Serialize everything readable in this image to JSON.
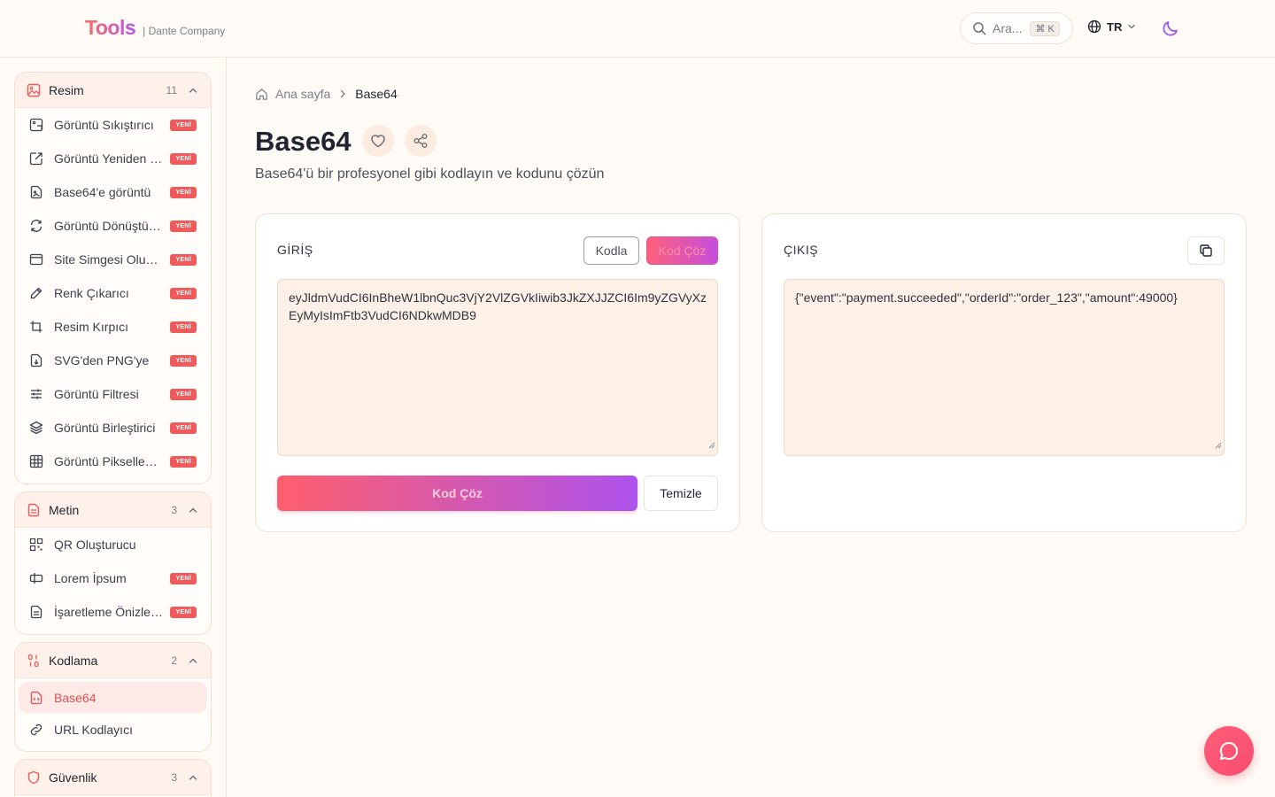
{
  "header": {
    "logo": "Tools",
    "company": "| Dante Company",
    "search_placeholder": "Ara...",
    "search_shortcut": "⌘ K",
    "language": "TR"
  },
  "sidebar": {
    "groups": [
      {
        "title": "Resim",
        "count": "11",
        "items": [
          {
            "label": "Görüntü Sıkıştırıcı",
            "badge": "YENİ"
          },
          {
            "label": "Görüntü Yeniden Boyutlandırıcı",
            "badge": "YENİ"
          },
          {
            "label": "Base64'e görüntü",
            "badge": "YENİ"
          },
          {
            "label": "Görüntü Dönüştürücü",
            "badge": "YENİ"
          },
          {
            "label": "Site Simgesi Oluşturucu",
            "badge": "YENİ"
          },
          {
            "label": "Renk Çıkarıcı",
            "badge": "YENİ"
          },
          {
            "label": "Resim Kırpıcı",
            "badge": "YENİ"
          },
          {
            "label": "SVG'den PNG'ye",
            "badge": "YENİ"
          },
          {
            "label": "Görüntü Filtresi",
            "badge": "YENİ"
          },
          {
            "label": "Görüntü Birleştirici",
            "badge": "YENİ"
          },
          {
            "label": "Görüntü Pikselleştirici",
            "badge": "YENİ"
          }
        ]
      },
      {
        "title": "Metin",
        "count": "3",
        "items": [
          {
            "label": "QR Oluşturucu",
            "badge": ""
          },
          {
            "label": "Lorem İpsum",
            "badge": "YENİ"
          },
          {
            "label": "İşaretleme Önizleyici",
            "badge": "YENİ"
          }
        ]
      },
      {
        "title": "Kodlama",
        "count": "2",
        "items": [
          {
            "label": "Base64",
            "badge": ""
          },
          {
            "label": "URL Kodlayıcı",
            "badge": ""
          }
        ]
      },
      {
        "title": "Güvenlik",
        "count": "3",
        "items": []
      }
    ]
  },
  "breadcrumb": {
    "home": "Ana sayfa",
    "current": "Base64"
  },
  "page": {
    "title": "Base64",
    "subtitle": "Base64'ü bir profesyonel gibi kodlayın ve kodunu çözün"
  },
  "input_panel": {
    "label": "GİRİŞ",
    "encode_label": "Kodla",
    "decode_label": "Kod Çöz",
    "value": "eyJldmVudCI6InBheW1lbnQuc3VjY2VlZGVkIiwib3JkZXJJZCI6Im9yZGVyXzEyMyIsImFtb3VudCI6NDkwMDB9",
    "primary_label": "Kod Çöz",
    "clear_label": "Temizle"
  },
  "output_panel": {
    "label": "ÇIKIŞ",
    "value": "{\"event\":\"payment.succeeded\",\"orderId\":\"order_123\",\"amount\":49000}"
  },
  "colors": {
    "accent": "#f05a5a",
    "gradient_start": "#ff5f6d",
    "gradient_end": "#ad52ee",
    "background": "#fefaf5"
  }
}
